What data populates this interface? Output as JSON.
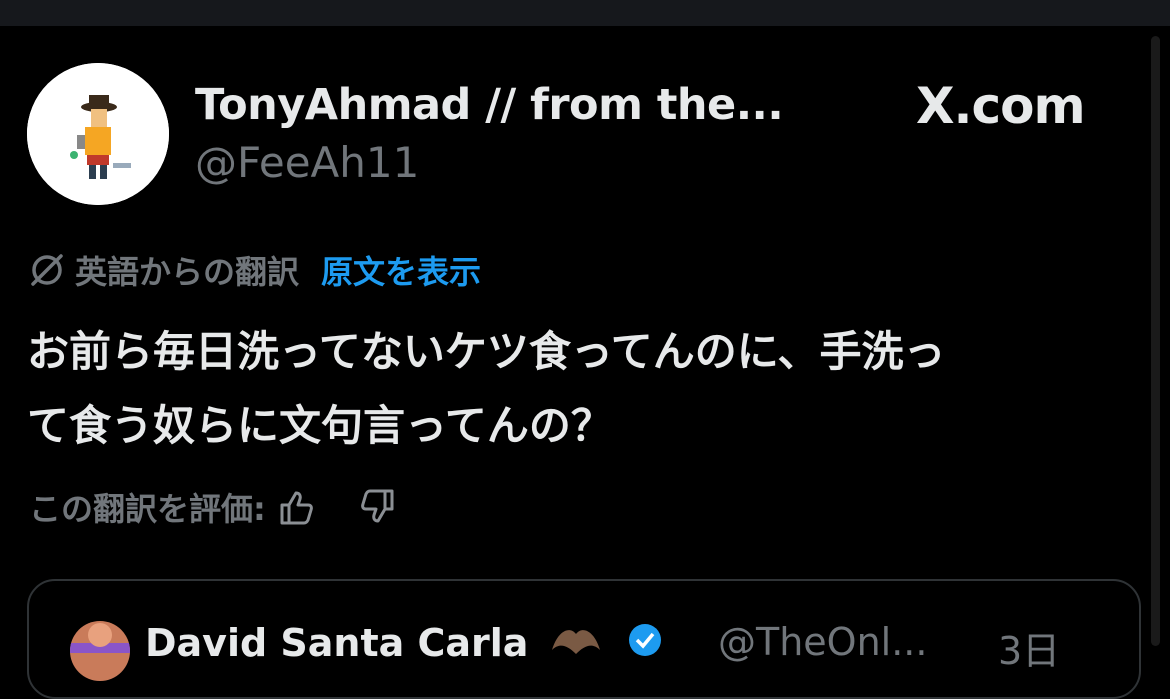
{
  "post": {
    "display_name": "TonyAhmad // from the...",
    "handle": "@FeeAh11",
    "brand": "X.com",
    "translation_label": "英語からの翻訳",
    "show_original": "原文を表示",
    "text_line1": "お前ら毎日洗ってないケツ食ってんのに、手洗っ",
    "text_line2": "て食う奴らに文句言ってんの？",
    "rate_label": "この翻訳を評価:"
  },
  "quoted": {
    "display_name": "David Santa Carla",
    "handle": "@TheOnl...",
    "time": "3日"
  },
  "colors": {
    "background": "#000000",
    "text": "#e7e9ea",
    "secondary": "#71767b",
    "accent": "#1d9bf0",
    "border": "#2f3336"
  },
  "icons": [
    "translate-icon",
    "thumbs-up-icon",
    "thumbs-down-icon",
    "bat-emoji-icon",
    "verified-badge-icon"
  ]
}
